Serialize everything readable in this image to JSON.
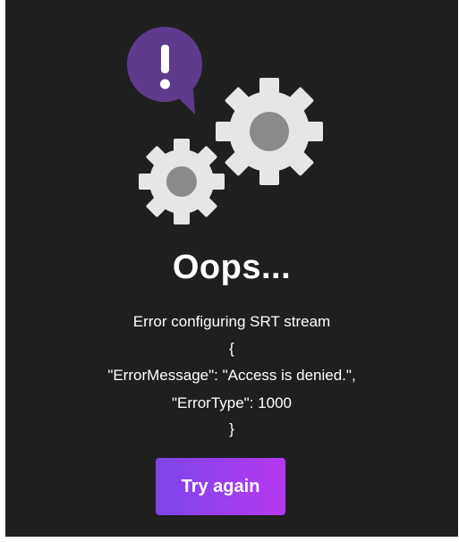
{
  "dialog": {
    "title": "Oops...",
    "error_lines": [
      "Error configuring SRT stream",
      "{",
      "\"ErrorMessage\": \"Access is denied.\",",
      "\"ErrorType\": 1000",
      "}"
    ],
    "retry_label": "Try again"
  },
  "icons": {
    "speech_bubble": "exclamation-speech-bubble-icon",
    "gears": "gears-icon"
  },
  "colors": {
    "background": "#1f1f1f",
    "speech_bubble": "#5e3b8c",
    "gear": "#e6e6e6",
    "gear_hub": "#8a8a8a",
    "button_gradient_start": "#7d45ea",
    "button_gradient_end": "#b638f0"
  }
}
